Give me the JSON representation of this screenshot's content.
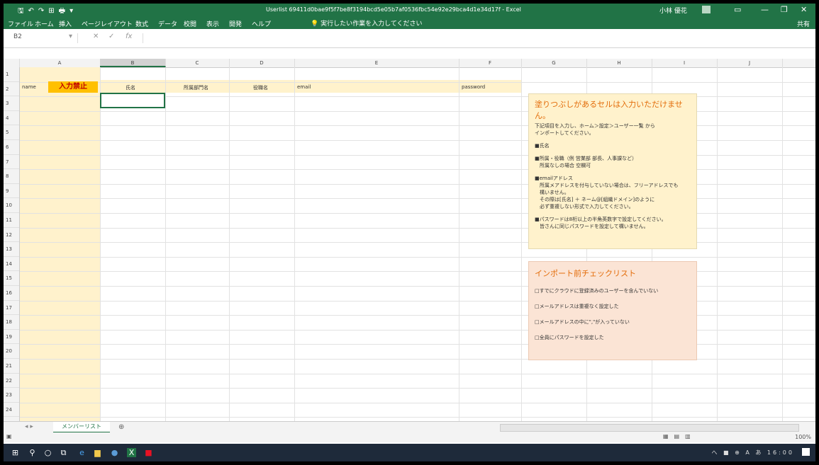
{
  "window": {
    "title": "Userlist 69411d0bae9f5f7be8f3194bcd5e05b7af0536fbc54e92e29bca4d1e34d17f - Excel",
    "user": "小林 優花",
    "controls": [
      "—",
      "❐",
      "✕"
    ]
  },
  "ribbon": {
    "tabs": [
      "ファイル",
      "ホーム",
      "挿入",
      "ページレイアウト",
      "数式",
      "データ",
      "校閲",
      "表示",
      "開発",
      "ヘルプ"
    ],
    "tell_me": "実行したい作業を入力してください",
    "share": "共有"
  },
  "formula_bar": {
    "name_box": "B2",
    "formula": ""
  },
  "columns": [
    "A",
    "B",
    "C",
    "D",
    "E",
    "F",
    "G",
    "H",
    "I",
    "J"
  ],
  "selected_column": "B",
  "rows": [
    "1",
    "2",
    "3",
    "4",
    "5",
    "6",
    "7",
    "8",
    "9",
    "10",
    "11",
    "12",
    "13",
    "14",
    "15",
    "16",
    "17",
    "18",
    "19",
    "20",
    "21",
    "22",
    "23",
    "24"
  ],
  "header_cells": {
    "name": "name",
    "lock": "入力禁止",
    "fullname": "氏名",
    "department": "所属部門名",
    "position": "役職名",
    "email": "email",
    "password": "password"
  },
  "info_box": {
    "heading": "塗りつぶしがあるセルは入力いただけません。",
    "lines": [
      "下記項目を入力し、ホーム＞設定＞ユーザー一覧 から",
      "インポートしてください。",
      "",
      "■氏名",
      "",
      "■所属・役職（例 営業部 部長、人事課など）",
      "　所属なしの場合 空欄可",
      "",
      "■emailアドレス",
      "　所属メアドレスを付与していない場合は、フリーアドレスでも",
      "　構いません。",
      "　その際は[氏名] ＋ ネーム@[組織ドメイン]のように",
      "　必ず重複しない形式で入力してください。",
      "",
      "■パスワードは8桁以上の半角英数字で設定してください。",
      "　皆さんに同じパスワードを設定して構いません。"
    ]
  },
  "checklist": {
    "heading": "インポート前チェックリスト",
    "items": [
      "□すでにクラウドに登録済みのユーザーを含んでいない",
      "□メールアドレスは重複なく設定した",
      "□メールアドレスの中に\",\"が入っていない",
      "□全員にパスワードを設定した"
    ]
  },
  "sheet_tab": "メンバーリスト",
  "status": {
    "zoom": "100%"
  },
  "taskbar": {
    "tray": "へ ■ ⊕ A あ 16:00"
  }
}
